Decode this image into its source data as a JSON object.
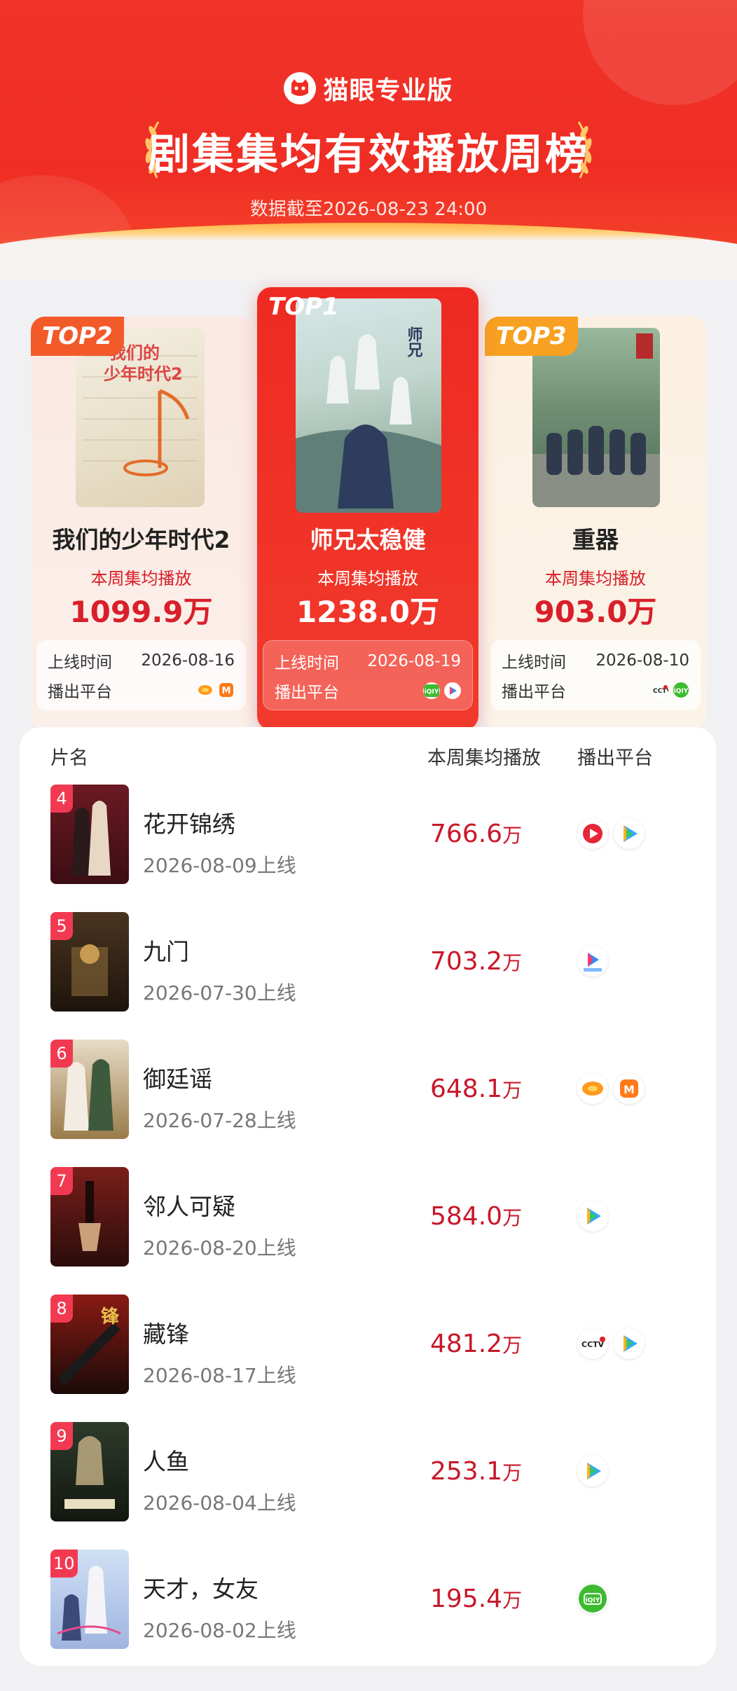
{
  "brand": "猫眼专业版",
  "title": "剧集集均有效播放周榜",
  "data_date": "数据截至2026-08-23 24:00",
  "top_labels": {
    "play": "本周集均播放",
    "online": "上线时间",
    "platform": "播出平台"
  },
  "top3": [
    {
      "rank": "TOP2",
      "name": "我们的少年时代2",
      "value": "1099.9万",
      "date": "2026-08-16",
      "platforms": [
        "mango-tv-orange-icon",
        "mango-tv-m-icon"
      ]
    },
    {
      "rank": "TOP1",
      "name": "师兄太稳健",
      "value": "1238.0万",
      "date": "2026-08-19",
      "platforms": [
        "iqiyi-icon",
        "youku-icon"
      ]
    },
    {
      "rank": "TOP3",
      "name": "重器",
      "value": "903.0万",
      "date": "2026-08-10",
      "platforms": [
        "cctv1-icon",
        "iqiyi-icon"
      ]
    }
  ],
  "list_header": {
    "name": "片名",
    "play": "本周集均播放",
    "platform": "播出平台"
  },
  "list": [
    {
      "rank": "4",
      "name": "花开锦绣",
      "date": "2026-08-09上线",
      "value": "766.6",
      "unit": "万",
      "platforms": [
        "tencent-video-icon",
        "tencent-play-icon"
      ]
    },
    {
      "rank": "5",
      "name": "九门",
      "date": "2026-07-30上线",
      "value": "703.2",
      "unit": "万",
      "platforms": [
        "youku-icon"
      ]
    },
    {
      "rank": "6",
      "name": "御廷谣",
      "date": "2026-07-28上线",
      "value": "648.1",
      "unit": "万",
      "platforms": [
        "mango-tv-orange-icon",
        "mango-tv-m-icon"
      ]
    },
    {
      "rank": "7",
      "name": "邻人可疑",
      "date": "2026-08-20上线",
      "value": "584.0",
      "unit": "万",
      "platforms": [
        "tencent-play-icon"
      ]
    },
    {
      "rank": "8",
      "name": "藏锋",
      "date": "2026-08-17上线",
      "value": "481.2",
      "unit": "万",
      "platforms": [
        "cctv1-icon",
        "tencent-play-icon"
      ]
    },
    {
      "rank": "9",
      "name": "人鱼",
      "date": "2026-08-04上线",
      "value": "253.1",
      "unit": "万",
      "platforms": [
        "tencent-play-icon"
      ]
    },
    {
      "rank": "10",
      "name": "天才，女友",
      "date": "2026-08-02上线",
      "value": "195.4",
      "unit": "万",
      "platforms": [
        "iqiyi-icon"
      ]
    }
  ],
  "colors": {
    "header_red": "#ef2d24",
    "value_red": "#c8182a",
    "badge_pink": "#f13a52",
    "top2_tag": "#f25a2a",
    "top3_tag": "#f7a021"
  }
}
